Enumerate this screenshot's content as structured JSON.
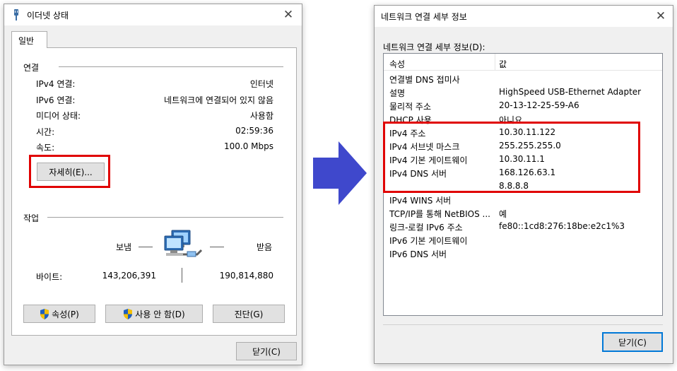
{
  "left": {
    "title": "이더넷 상태",
    "tab": "일반",
    "connection_group": "연결",
    "rows": [
      {
        "label": "IPv4 연결:",
        "value": "인터넷"
      },
      {
        "label": "IPv6 연결:",
        "value": "네트워크에 연결되어 있지 않음"
      },
      {
        "label": "미디어 상태:",
        "value": "사용함"
      },
      {
        "label": "시간:",
        "value": "02:59:36"
      },
      {
        "label": "속도:",
        "value": "100.0 Mbps"
      }
    ],
    "details_button": "자세히(E)...",
    "activity_group": "작업",
    "sent_label": "보냄",
    "received_label": "받음",
    "bytes_label": "바이트:",
    "bytes_sent": "143,206,391",
    "bytes_received": "190,814,880",
    "properties_button": "속성(P)",
    "disable_button": "사용 안 함(D)",
    "diagnose_button": "진단(G)",
    "close_button": "닫기(C)"
  },
  "right": {
    "title": "네트워크 연결 세부 정보",
    "section_label": "네트워크 연결 세부 정보(D):",
    "col_property": "속성",
    "col_value": "값",
    "rows": [
      {
        "prop": "연결별 DNS 접미사",
        "val": ""
      },
      {
        "prop": "설명",
        "val": "HighSpeed USB-Ethernet Adapter"
      },
      {
        "prop": "물리적 주소",
        "val": "20-13-12-25-59-A6"
      },
      {
        "prop": "DHCP 사용",
        "val": "아니요"
      },
      {
        "prop": "IPv4 주소",
        "val": "10.30.11.122"
      },
      {
        "prop": "IPv4 서브넷 마스크",
        "val": "255.255.255.0"
      },
      {
        "prop": "IPv4 기본 게이트웨이",
        "val": "10.30.11.1"
      },
      {
        "prop": "IPv4 DNS 서버",
        "val": "168.126.63.1"
      },
      {
        "prop": "",
        "val": "8.8.8.8"
      },
      {
        "prop": "IPv4 WINS 서버",
        "val": ""
      },
      {
        "prop": "TCP/IP를 통해 NetBIOS ...",
        "val": "예"
      },
      {
        "prop": "링크-로컬 IPv6 주소",
        "val": "fe80::1cd8:276:18be:e2c1%3"
      },
      {
        "prop": "IPv6 기본 게이트웨이",
        "val": ""
      },
      {
        "prop": "IPv6 DNS 서버",
        "val": ""
      }
    ],
    "close_button": "닫기(C)"
  },
  "colors": {
    "highlight": "#e00000",
    "arrow": "#3f48cc",
    "accent": "#0078d7",
    "window_bg": "#f0f0f0"
  },
  "icons": {
    "window": "ethernet-plug-icon",
    "activity": "network-computers-icon",
    "uac": "uac-shield-icon",
    "close": "close-icon",
    "arrow": "right-arrow-icon"
  }
}
